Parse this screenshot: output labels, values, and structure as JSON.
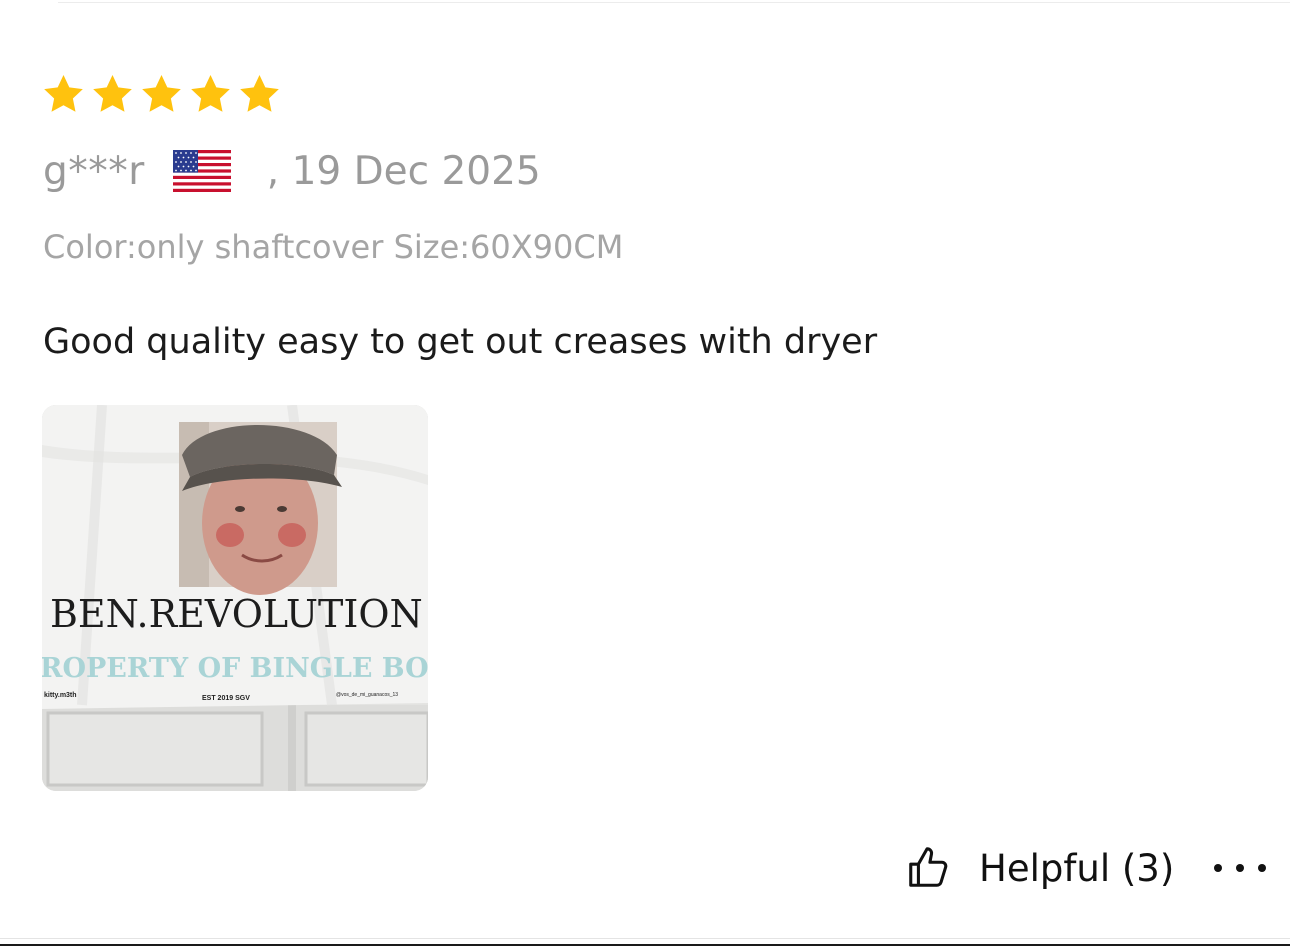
{
  "review": {
    "rating": 5,
    "rating_max": 5,
    "star_color": "#FFC20E",
    "username": "g***r",
    "country_flag_icon": "us-flag-icon",
    "date": ", 19 Dec 2025",
    "sku": "Color:only shaftcover Size:60X90CM",
    "text": "Good quality easy to get out creases with dryer",
    "photo": {
      "banner_title": "BEN.REVOLUTION",
      "banner_subtitle": "ROPERTY OF BINGLE BO",
      "banner_left_tag": "kitty.m3th",
      "banner_center_tag": "EST 2019 SGV",
      "banner_right_tag": "@vos_de_mi_guanacos_13"
    },
    "helpful_label": "Helpful (3)",
    "helpful_icon": "thumbs-up-icon",
    "more_icon": "more-options-icon"
  }
}
